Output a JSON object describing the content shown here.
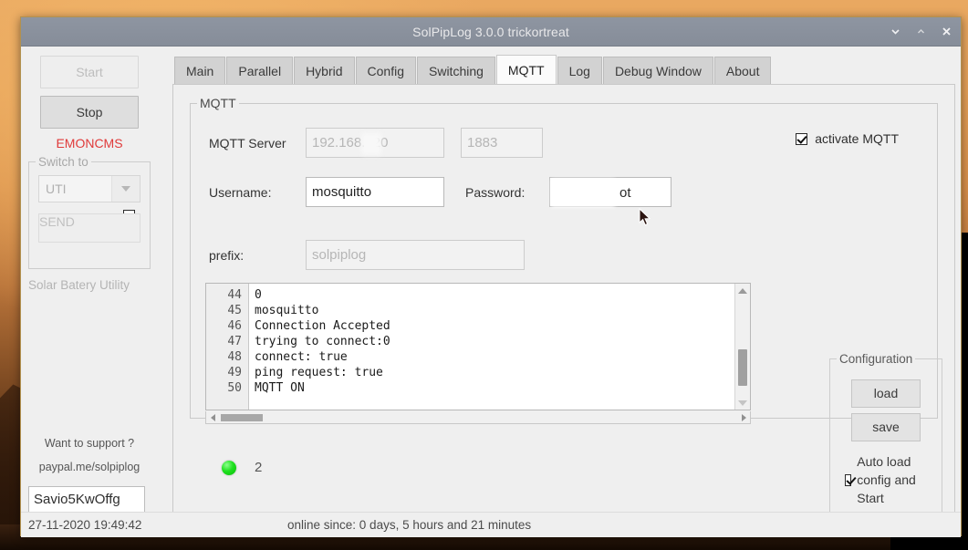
{
  "window": {
    "title": "SolPipLog 3.0.0 trickortreat",
    "controls": [
      {
        "name": "minimize-button",
        "glyph": "chevron-down"
      },
      {
        "name": "maximize-button",
        "glyph": "chevron-up"
      },
      {
        "name": "close-button",
        "glyph": "x"
      }
    ]
  },
  "sidebar": {
    "start_label": "Start",
    "stop_label": "Stop",
    "emoncms_label": "EMONCMS",
    "emoncms_color": "#e03a3a",
    "emoncms_checkbox_checked": false,
    "switch_group_title": "Switch to",
    "switch_combo_value": "UTI",
    "send_label": "SEND",
    "solar_line": "Solar Batery Utility",
    "support_question": "Want to support ?",
    "support_link": "paypal.me/solpiplog",
    "device_field_value": "Savio5KwOffg"
  },
  "tabs": [
    {
      "label": "Main",
      "active": false
    },
    {
      "label": "Parallel",
      "active": false
    },
    {
      "label": "Hybrid",
      "active": false
    },
    {
      "label": "Config",
      "active": false
    },
    {
      "label": "Switching",
      "active": false
    },
    {
      "label": "MQTT",
      "active": true
    },
    {
      "label": "Log",
      "active": false
    },
    {
      "label": "Debug Window",
      "active": false
    },
    {
      "label": "About",
      "active": false
    }
  ],
  "mqtt": {
    "group_title": "MQTT",
    "server_label": "MQTT Server",
    "server_value": "192.168.   .20",
    "port_value": "1883",
    "activate_label": "activate MQTT",
    "activate_checked": true,
    "username_label": "Username:",
    "username_value": "mosquitto",
    "password_label": "Password:",
    "password_value": "ot",
    "prefix_label": "prefix:",
    "prefix_value": "solpiplog"
  },
  "log": {
    "line_numbers": "44\n45\n46\n47\n48\n49\n50",
    "lines": "0\nmosquitto\nConnection Accepted\ntrying to connect:0\nconnect: true\nping request: true\nMQTT ON"
  },
  "indicator": {
    "led_color": "#20e020",
    "count": "2"
  },
  "configuration": {
    "group_title": "Configuration",
    "load_label": "load",
    "save_label": "save",
    "autoload_label": "Auto load config and Start",
    "autoload_checked": true
  },
  "statusbar": {
    "datetime": "27-11-2020 19:49:42",
    "online_since": "online since: 0 days, 5 hours  and 21 minutes"
  }
}
